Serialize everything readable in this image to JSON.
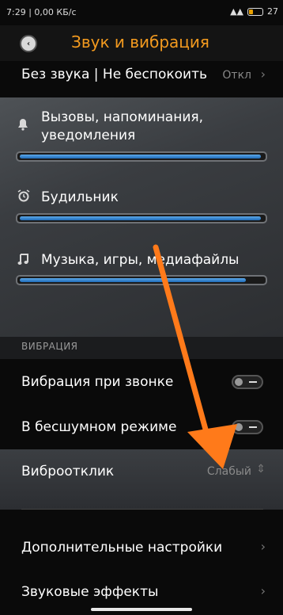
{
  "status": {
    "time": "7:29",
    "net": "| 0,00 КБ/с",
    "battery": "27"
  },
  "header": {
    "title": "Звук и вибрация",
    "back_label": "‹"
  },
  "rows": {
    "dnd": {
      "label": "Без звука | Не беспокоить",
      "value": "Откл"
    },
    "calls": {
      "label": "Вызовы, напоминания, уведомления",
      "level": 0.99
    },
    "alarm": {
      "label": "Будильник",
      "level": 0.99
    },
    "media": {
      "label": "Музыка, игры, медиафайлы",
      "level": 0.93
    },
    "vibration_header": "ВИБРАЦИЯ",
    "vibrate_on_ring": {
      "label": "Вибрация при звонке",
      "state": "off"
    },
    "vibrate_silent": {
      "label": "В бесшумном режиме",
      "state": "off"
    },
    "haptic": {
      "label": "Виброотклик",
      "value": "Слабый"
    },
    "more": {
      "label": "Дополнительные настройки"
    },
    "effects": {
      "label": "Звуковые эффекты"
    }
  },
  "colors": {
    "accent": "#f39a1f",
    "arrow": "#ff7a1a",
    "slider": "#2f86d6"
  },
  "icons": {
    "bell": "bell-icon",
    "alarm": "alarm-clock-icon",
    "music": "music-note-icon"
  }
}
